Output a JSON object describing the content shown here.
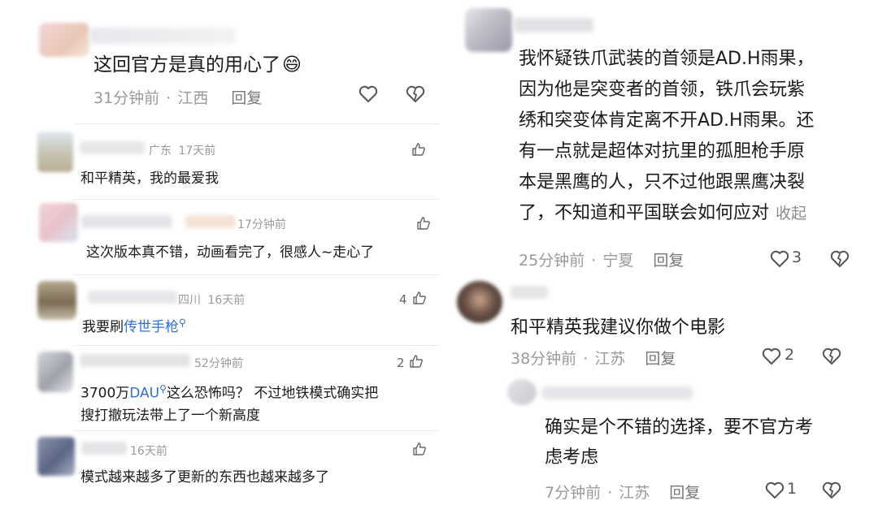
{
  "left_panel": {
    "top_comment": {
      "text": "这回官方是真的用心了",
      "emoji": "😄",
      "time": "31分钟前",
      "region": "江西",
      "reply": "回复"
    },
    "comments": [
      {
        "region": "广东",
        "time": "17天前",
        "text": "和平精英，我的最爱我",
        "likes": ""
      },
      {
        "region": "",
        "time": "17分钟前",
        "text": "这次版本真不错，动画看完了，很感人~走心了",
        "likes": ""
      },
      {
        "region": "四川",
        "time": "16天前",
        "text_prefix": "我要刷",
        "text_link": "传世手枪",
        "likes": "4"
      },
      {
        "region": "",
        "time": "52分钟前",
        "text_part1": "3700万",
        "text_link": "DAU",
        "text_part2": "这么恐怖吗？ 不过地铁模式确实把",
        "text_line2": "搜打撤玩法带上了一个新高度",
        "likes": "2"
      },
      {
        "region": "",
        "time": "16天前",
        "text": "模式越来越多了更新的东西也越来越多了",
        "likes": ""
      }
    ],
    "separator": "·"
  },
  "right_panel": {
    "main_comment": {
      "lines": [
        "我怀疑铁爪武装的首领是AD.H雨果，",
        "因为他是突变者的首领，铁爪会玩紫",
        "绣和突变体肯定离不开AD.H雨果。还",
        "有一点就是超体对抗里的孤胆枪手原",
        "本是黑鹰的人，只不过他跟黑鹰决裂",
        "了，不知道和平国联会如何应对"
      ],
      "collapse": "收起",
      "time": "25分钟前",
      "region": "宁夏",
      "reply": "回复",
      "likes": "3"
    },
    "second_comment": {
      "text": "和平精英我建议你做个电影",
      "time": "38分钟前",
      "region": "江苏",
      "reply": "回复",
      "likes": "2"
    },
    "reply_comment": {
      "lines": [
        "确实是个不错的选择，要不官方考",
        "虑考虑"
      ],
      "time": "7分钟前",
      "region": "江苏",
      "reply": "回复",
      "likes": "1"
    }
  },
  "icons": {
    "heart": "heart-icon",
    "dislike": "broken-heart-icon",
    "thumb": "thumbs-up-icon"
  }
}
